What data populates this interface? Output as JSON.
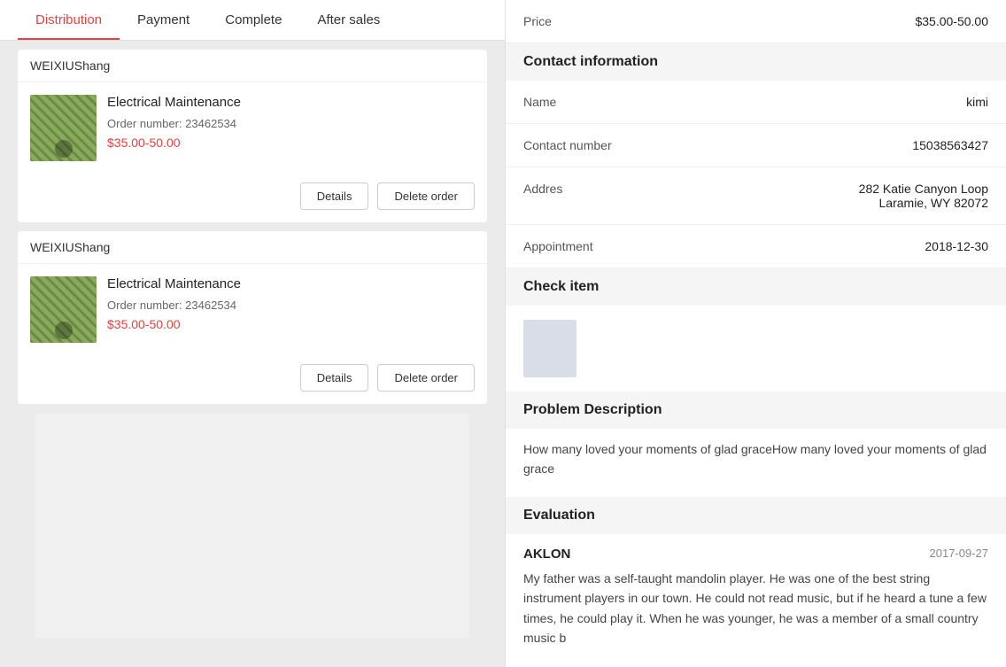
{
  "tabs": [
    {
      "label": "Distribution",
      "active": true
    },
    {
      "label": "Payment",
      "active": false
    },
    {
      "label": "Complete",
      "active": false
    },
    {
      "label": "After sales",
      "active": false
    }
  ],
  "orders": [
    {
      "seller": "WEIXIUShang",
      "title": "Electrical Maintenance",
      "order_number_label": "Order number:",
      "order_number": "23462534",
      "price": "$35.00-50.00",
      "btn_details": "Details",
      "btn_delete": "Delete order"
    },
    {
      "seller": "WEIXIUShang",
      "title": "Electrical Maintenance",
      "order_number_label": "Order number:",
      "order_number": "23462534",
      "price": "$35.00-50.00",
      "btn_details": "Details",
      "btn_delete": "Delete order"
    }
  ],
  "detail": {
    "price_label": "Price",
    "price_value": "$35.00-50.00",
    "contact_section": "Contact information",
    "name_label": "Name",
    "name_value": "kimi",
    "contact_label": "Contact number",
    "contact_value": "15038563427",
    "address_label": "Addres",
    "address_value": "282 Katie Canyon Loop\nLaramie, WY 82072",
    "appointment_label": "Appointment",
    "appointment_value": "2018-12-30",
    "check_section": "Check item",
    "problem_section": "Problem Description",
    "problem_text": "How many loved your moments of glad graceHow many loved your moments of glad grace",
    "eval_section": "Evaluation",
    "eval_name": "AKLON",
    "eval_date": "2017-09-27",
    "eval_text": "My father was a self-taught mandolin player. He was one of the best string instrument players in our town. He could not read music, but if he heard a tune a few times, he could play it. When he was younger, he was a member of a small country music b"
  }
}
